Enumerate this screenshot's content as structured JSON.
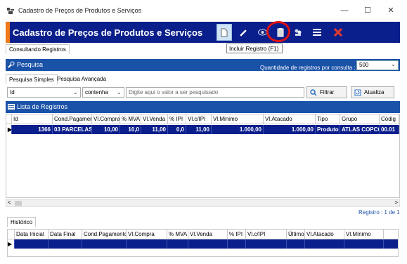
{
  "window": {
    "title": "Cadastro de Preços de Produtos e Serviços",
    "minimize": "—",
    "maximize": "☐",
    "close": "✕"
  },
  "header": {
    "title": "Cadastro de Preços de Produtos e Serviços",
    "accent_color": "#f07a1a",
    "bg_color": "#0b1f8c"
  },
  "toolbar": {
    "icons": [
      "new-document-icon",
      "edit-pencil-icon",
      "view-eye-icon",
      "insert-record-icon",
      "users-icon",
      "menu-icon",
      "delete-x-icon"
    ],
    "tooltip": "Incluir Registro (F1)"
  },
  "tabs": {
    "consulting": "Consultando Registros"
  },
  "search_panel": {
    "title": "Pesquisa",
    "quantity_label": "Quantidade de registros por consulta :",
    "quantity_value": "500",
    "tab_simple": "Pesquisa Simples",
    "tab_advanced": "Pesquisa Avançada",
    "field": "Id",
    "operator": "contenha",
    "placeholder": "Digite aqui o valor a ser pesquisado",
    "filter_button": "Filtrar",
    "refresh_button": "Atualiza"
  },
  "list": {
    "title": "Lista de Registros",
    "columns": [
      "Id",
      "Cond.Pagamento",
      "Vl.Compra",
      "% MVA",
      "Vl.Venda",
      "% IPI",
      "Vl.c/IPI",
      "Vl.Minimo",
      "Vl.Atacado",
      "Tipo",
      "Grupo",
      "Códig"
    ],
    "rows": [
      [
        "1366",
        "03 PARCELAS",
        "10,00",
        "10,0",
        "11,00",
        "0,0",
        "11,00",
        "1.000,00",
        "1.000,00",
        "Produto",
        "ATLAS COPCO",
        "00.01"
      ]
    ],
    "row_indicator": "▶",
    "record_count": "Registro : 1 de 1"
  },
  "history": {
    "tab": "Histórico",
    "columns": [
      "Data Inicial",
      "Data Final",
      "Cond.Pagamento",
      "Vl.Compra",
      "% MVA",
      "Vl.Venda",
      "% IPI",
      "Vl.c/IPI",
      "Último",
      "Vl.Atacado",
      "Vl.Mínimo"
    ],
    "row_indicator": "▶"
  },
  "scroll": {
    "left": "<",
    "right": ">"
  }
}
